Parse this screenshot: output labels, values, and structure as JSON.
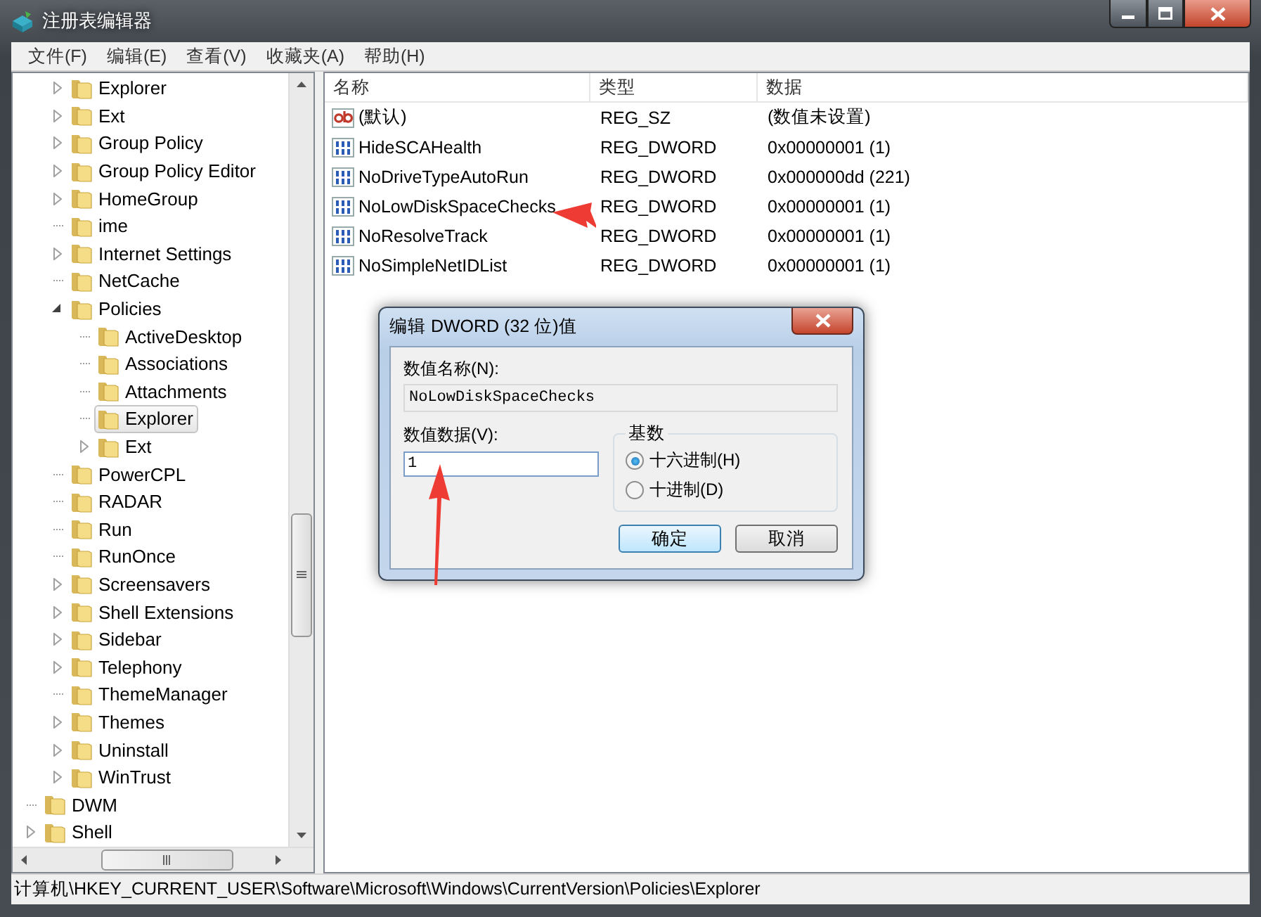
{
  "window": {
    "title": "注册表编辑器"
  },
  "menu": [
    "文件(F)",
    "编辑(E)",
    "查看(V)",
    "收藏夹(A)",
    "帮助(H)"
  ],
  "tree": [
    {
      "children": [
        {
          "label": "Explorer",
          "expandable": true,
          "expanded": false,
          "selected": false
        },
        {
          "label": "Ext",
          "expandable": true,
          "expanded": false,
          "selected": false
        },
        {
          "label": "Group Policy",
          "expandable": true,
          "expanded": false,
          "selected": false
        },
        {
          "label": "Group Policy Editor",
          "expandable": true,
          "expanded": false,
          "selected": false
        },
        {
          "label": "HomeGroup",
          "expandable": true,
          "expanded": false,
          "selected": false
        },
        {
          "label": "ime",
          "expandable": false,
          "selected": false
        },
        {
          "label": "Internet Settings",
          "expandable": true,
          "expanded": false,
          "selected": false
        },
        {
          "label": "NetCache",
          "expandable": false,
          "selected": false
        },
        {
          "label": "Policies",
          "expandable": true,
          "expanded": true,
          "selected": false,
          "children": [
            {
              "label": "ActiveDesktop",
              "expandable": false,
              "selected": false
            },
            {
              "label": "Associations",
              "expandable": false,
              "selected": false
            },
            {
              "label": "Attachments",
              "expandable": false,
              "selected": false
            },
            {
              "label": "Explorer",
              "expandable": false,
              "selected": true
            },
            {
              "label": "Ext",
              "expandable": true,
              "expanded": false,
              "selected": false
            }
          ]
        },
        {
          "label": "PowerCPL",
          "expandable": false,
          "selected": false
        },
        {
          "label": "RADAR",
          "expandable": false,
          "selected": false
        },
        {
          "label": "Run",
          "expandable": false,
          "selected": false
        },
        {
          "label": "RunOnce",
          "expandable": false,
          "selected": false
        },
        {
          "label": "Screensavers",
          "expandable": true,
          "expanded": false,
          "selected": false
        },
        {
          "label": "Shell Extensions",
          "expandable": true,
          "expanded": false,
          "selected": false
        },
        {
          "label": "Sidebar",
          "expandable": true,
          "expanded": false,
          "selected": false
        },
        {
          "label": "Telephony",
          "expandable": true,
          "expanded": false,
          "selected": false
        },
        {
          "label": "ThemeManager",
          "expandable": false,
          "selected": false
        },
        {
          "label": "Themes",
          "expandable": true,
          "expanded": false,
          "selected": false
        },
        {
          "label": "Uninstall",
          "expandable": true,
          "expanded": false,
          "selected": false
        },
        {
          "label": "WinTrust",
          "expandable": true,
          "expanded": false,
          "selected": false
        }
      ]
    },
    {
      "label": "DWM",
      "expandable": false,
      "selected": false
    },
    {
      "label": "Shell",
      "expandable": true,
      "expanded": false,
      "selected": false
    }
  ],
  "list": {
    "columns": [
      "名称",
      "类型",
      "数据"
    ],
    "rows": [
      {
        "kind": "string",
        "name": "(默认)",
        "type": "REG_SZ",
        "data": "(数值未设置)"
      },
      {
        "kind": "dword",
        "name": "HideSCAHealth",
        "type": "REG_DWORD",
        "data": "0x00000001 (1)"
      },
      {
        "kind": "dword",
        "name": "NoDriveTypeAutoRun",
        "type": "REG_DWORD",
        "data": "0x000000dd (221)"
      },
      {
        "kind": "dword",
        "name": "NoLowDiskSpaceChecks",
        "type": "REG_DWORD",
        "data": "0x00000001 (1)"
      },
      {
        "kind": "dword",
        "name": "NoResolveTrack",
        "type": "REG_DWORD",
        "data": "0x00000001 (1)"
      },
      {
        "kind": "dword",
        "name": "NoSimpleNetIDList",
        "type": "REG_DWORD",
        "data": "0x00000001 (1)"
      }
    ]
  },
  "dialog": {
    "title": "编辑 DWORD (32 位)值",
    "name_label": "数值名称(N):",
    "name_value": "NoLowDiskSpaceChecks",
    "data_label": "数值数据(V):",
    "data_value": "1",
    "base_label": "基数",
    "bases": [
      {
        "label": "十六进制(H)",
        "selected": true
      },
      {
        "label": "十进制(D)",
        "selected": false
      }
    ],
    "buttons": [
      {
        "label": "确定",
        "default": true
      },
      {
        "label": "取消",
        "default": false
      }
    ]
  },
  "status_bar": "计算机\\HKEY_CURRENT_USER\\Software\\Microsoft\\Windows\\CurrentVersion\\Policies\\Explorer"
}
